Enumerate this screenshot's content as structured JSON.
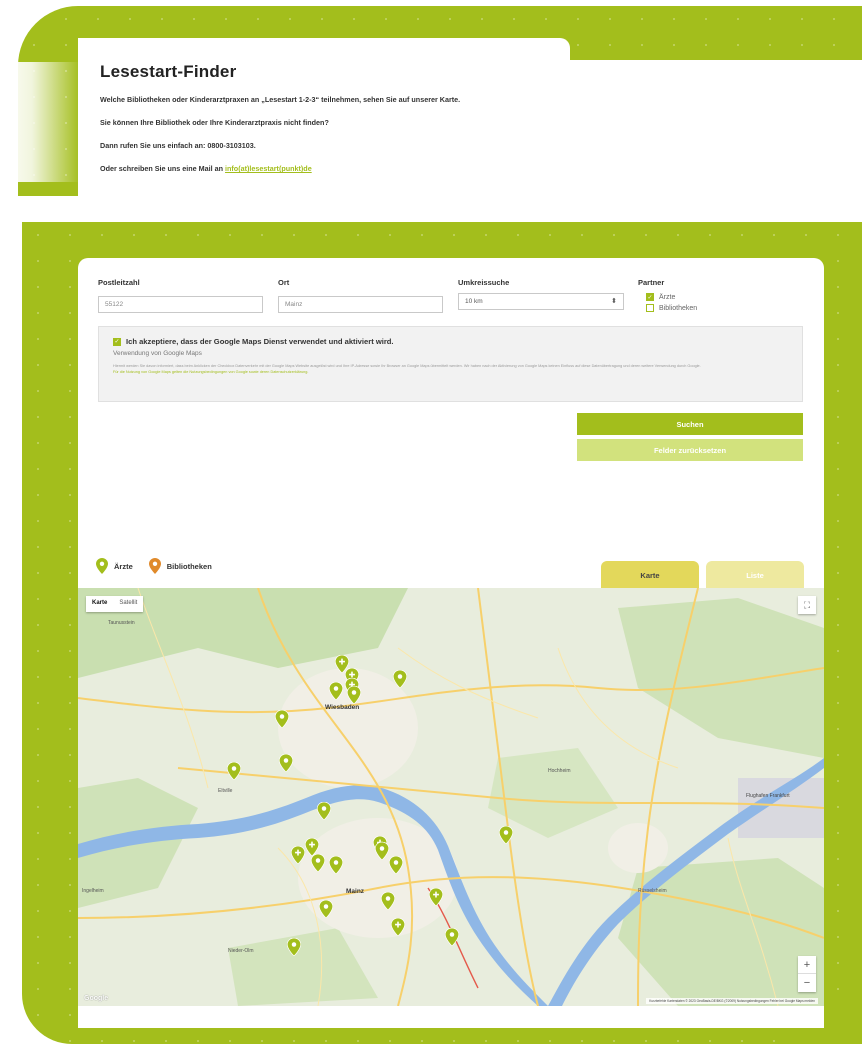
{
  "intro": {
    "title": "Lesestart-Finder",
    "p1": "Welche Bibliotheken oder Kinderarztpraxen an „Lesestart 1-2-3“ teilnehmen, sehen Sie auf unserer Karte.",
    "p2": "Sie können Ihre Bibliothek oder Ihre Kinderarztpraxis nicht finden?",
    "p3": "Dann rufen Sie uns einfach an: 0800-3103103.",
    "p4": "Oder schreiben Sie uns eine Mail an",
    "mail": "info(at)lesestart(punkt)de"
  },
  "form": {
    "plz_label": "Postleitzahl",
    "plz_value": "55122",
    "ort_label": "Ort",
    "ort_value": "Mainz",
    "radius_label": "Umkreissuche",
    "radius_value": "10 km",
    "partner_label": "Partner",
    "partner_aerzte": "Ärzte",
    "partner_bibliotheken": "Bibliotheken",
    "partner_aerzte_checked": true,
    "partner_bibliotheken_checked": false
  },
  "consent": {
    "title": "Ich akzeptiere, dass der Google Maps Dienst verwendet und aktiviert wird.",
    "subtitle": "Verwendung von Google Maps",
    "small1": "Hiermit werden Sie davon informiert, dass beim Anklicken der Checkbox Datenverkehr mit der Google Maps Website ausgelöst wird und Ihre IP-Adresse sowie Ihr Browser an Google Maps übermittelt werden. Wir haben nach der Aktivierung von Google Maps keinen Einfluss auf diese Datenübertragung und deren weitere Verwendung durch Google.",
    "small2": "Für die Nutzung von Google Maps gelten die Nutzungsbedingungen von Google sowie deren Datenschutzerklärung."
  },
  "buttons": {
    "search": "Suchen",
    "reset": "Felder zurücksetzen"
  },
  "legend": {
    "aerzte": "Ärzte",
    "bibliotheken": "Bibliotheken"
  },
  "tabs": {
    "karte": "Karte",
    "liste": "Liste"
  },
  "map": {
    "type_map": "Karte",
    "type_satellite": "Satellit",
    "fullscreen_icon": "fullscreen-icon",
    "zoom_in": "+",
    "zoom_out": "−",
    "google": "Google",
    "attribution": "Kurzbefehle   Kartendaten © 2023 GeoBasis-DE/BKG (©2009)   Nutzungsbedingungen   Fehler bei Google Maps melden",
    "city_wiesbaden": "Wiesbaden",
    "city_mainz": "Mainz",
    "label_taunus": "Taunusstein",
    "label_eltville": "Eltville",
    "label_hochheim": "Hochheim",
    "label_ruesselsheim": "Rüsselsheim",
    "label_nieder_olm": "Nieder-Olm",
    "label_flughafen": "Flughafen Frankfurt",
    "label_ingelheim": "Ingelheim",
    "colors": {
      "green": "#a3be1c",
      "orange": "#e08a2b",
      "river": "#8fb7e6",
      "road": "#f7d06b"
    }
  }
}
